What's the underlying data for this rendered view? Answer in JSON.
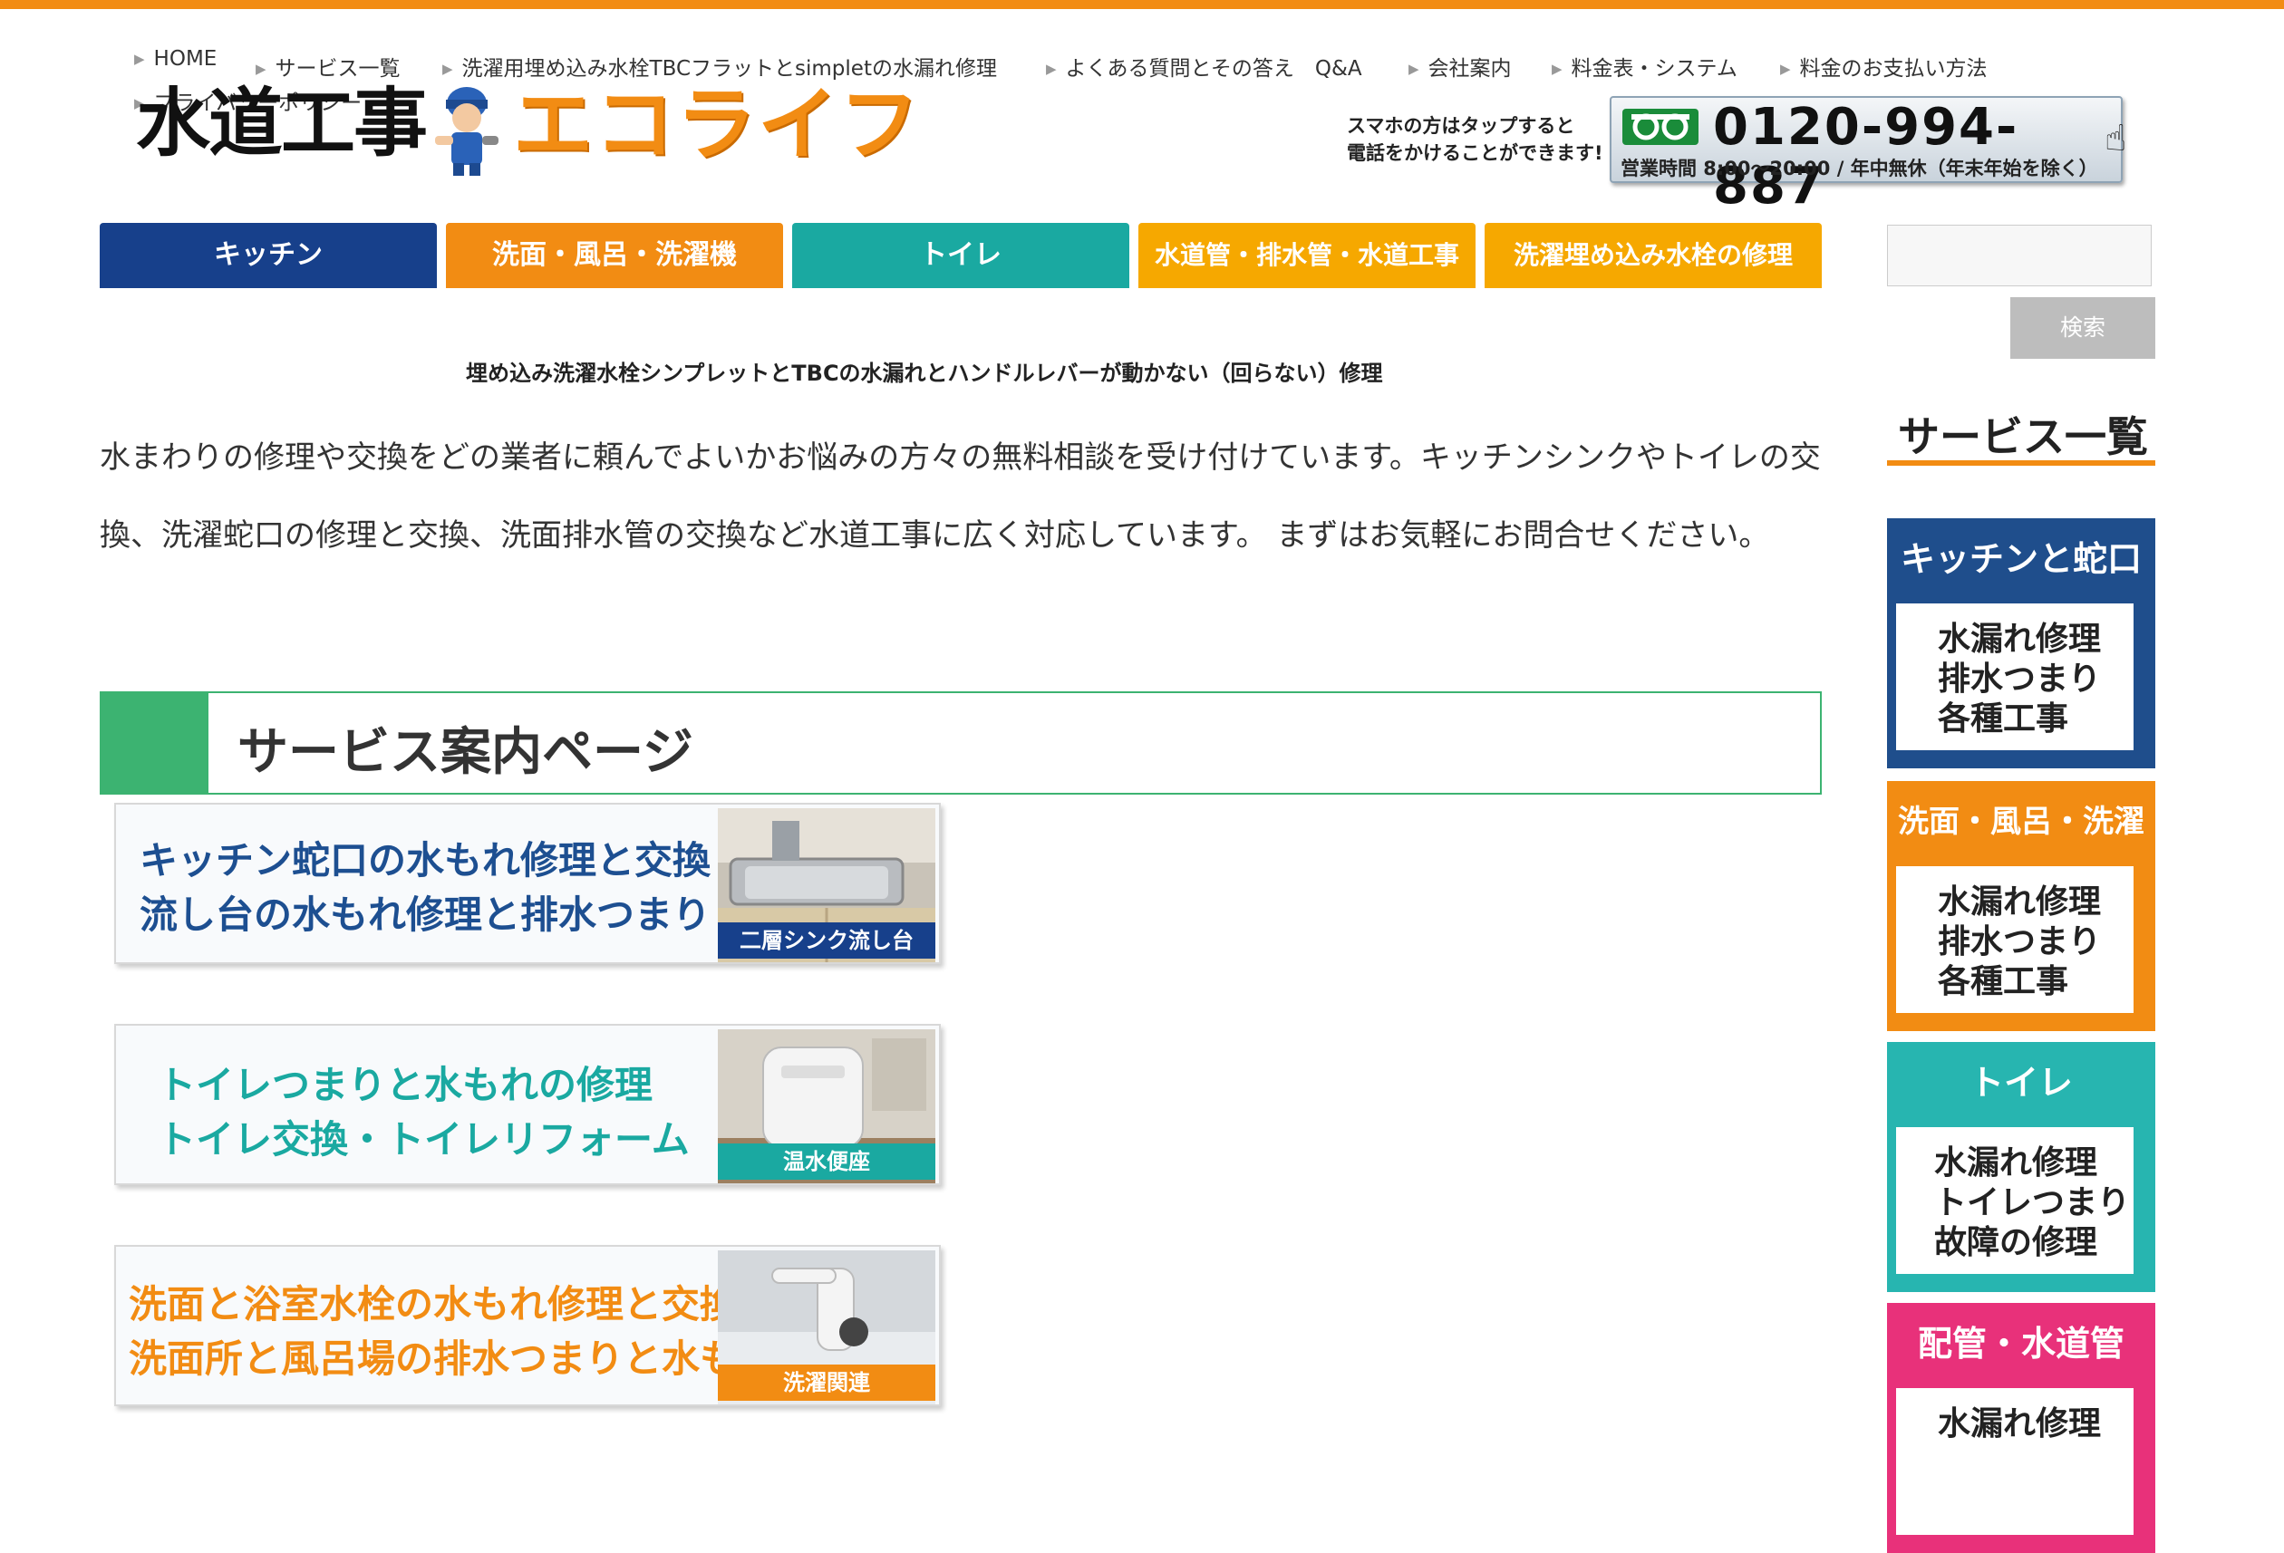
{
  "top_links": [
    "HOME",
    "サービス一覧",
    "洗濯用埋め込み水栓TBCフラットとsimpletの水漏れ修理",
    "よくある質問とその答え　Q&A",
    "会社案内",
    "料金表・システム",
    "料金のお支払い方法",
    "プライバシーポリシー"
  ],
  "logo": {
    "part1": "水道工事",
    "part2": "エコライフ"
  },
  "phone": {
    "note_line1": "スマホの方はタップすると",
    "note_line2": "電話をかけることができます!",
    "freedial": "ﾌﾘｰ",
    "number": "0120-994-887",
    "hours": "営業時間 8:00～20:00 / 年中無休（年末年始を除く）"
  },
  "nav": [
    {
      "label": "キッチン",
      "color": "#17408b"
    },
    {
      "label": "洗面・風呂・洗濯機",
      "color": "#f28c13"
    },
    {
      "label": "トイレ",
      "color": "#1aa9a1"
    },
    {
      "label": "水道管・排水管・水道工事",
      "color": "#f6a800"
    },
    {
      "label": "洗濯埋め込み水栓の修理",
      "color": "#f6a800"
    }
  ],
  "search": {
    "button": "検索",
    "placeholder": ""
  },
  "main": {
    "heading": "埋め込み洗濯水栓シンプレットとTBCの水漏れとハンドルレバーが動かない（回らない）修理",
    "intro": "水まわりの修理や交換をどの業者に頼んでよいかお悩みの方々の無料相談を受け付けています。キッチンシンクやトイレの交換、洗濯蛇口の修理と交換、洗面排水管の交換など水道工事に広く対応しています。 まずはお気軽にお問合せください。",
    "section_title": "サービス案内ページ",
    "banners": [
      {
        "line1": "キッチン蛇口の水もれ修理と交換",
        "line2": "流し台の水もれ修理と排水つまり",
        "caption": "二層シンク流し台",
        "text_color": "#1d4f91",
        "caption_color": "#17408b"
      },
      {
        "line1": "トイレつまりと水もれの修理",
        "line2": "トイレ交換・トイレリフォーム",
        "caption": "温水便座",
        "text_color": "#1aa9a1",
        "caption_color": "#1aa9a1"
      },
      {
        "line1": "洗面と浴室水栓の水もれ修理と交換",
        "line2": "洗面所と風呂場の排水つまりと水もれ",
        "caption": "洗濯関連",
        "text_color": "#f28c13",
        "caption_color": "#f28c13"
      }
    ]
  },
  "sidebar": {
    "title": "サービス一覧",
    "cards": [
      {
        "header": "キッチンと蛇口",
        "lines": [
          "水漏れ修理",
          "排水つまり",
          "各種工事"
        ],
        "color": "#1f4e8c"
      },
      {
        "header": "洗面・風呂・洗濯",
        "lines": [
          "水漏れ修理",
          "排水つまり",
          "各種工事"
        ],
        "color": "#f28c13"
      },
      {
        "header": "トイレ",
        "lines": [
          "水漏れ修理",
          "トイレつまり",
          "故障の修理"
        ],
        "color": "#27b5b0"
      },
      {
        "header": "配管・水道管",
        "lines": [
          "水漏れ修理"
        ],
        "color": "#e8317a"
      }
    ]
  }
}
